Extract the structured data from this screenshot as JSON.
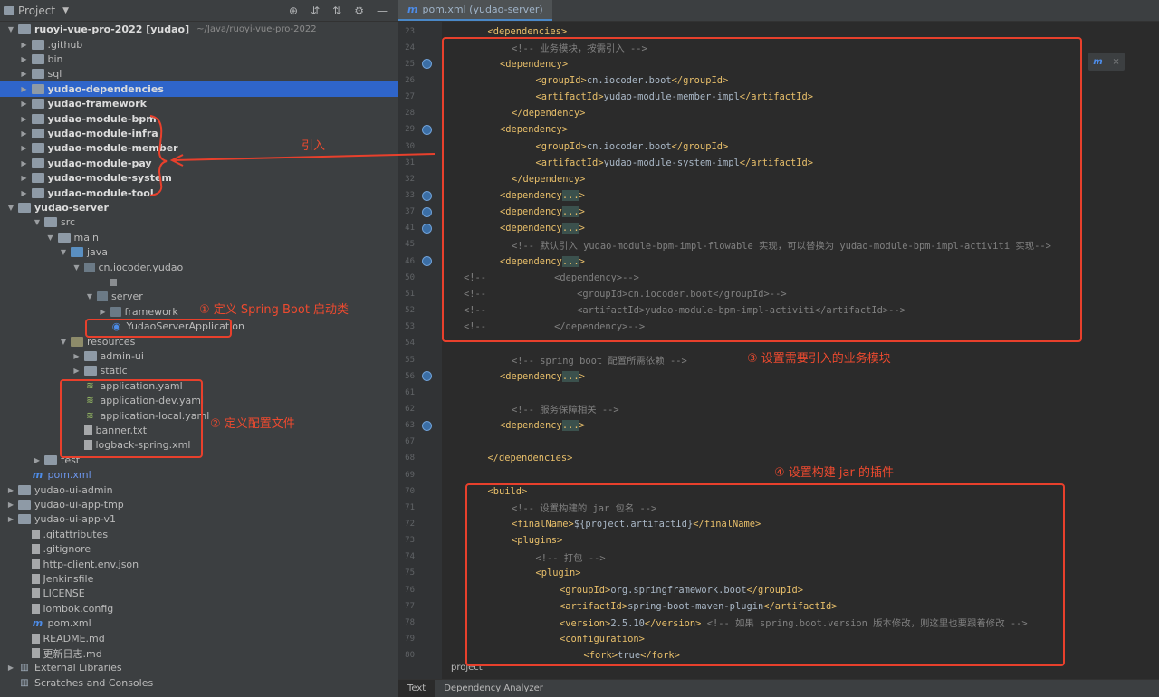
{
  "project_panel": {
    "title": "Project",
    "tree": [
      {
        "indent": 0,
        "arrow": "open",
        "icon": "folder",
        "label": "ruoyi-vue-pro-2022 [yudao]",
        "bold": true,
        "hint": "~/Java/ruoyi-vue-pro-2022"
      },
      {
        "indent": 1,
        "arrow": "closed",
        "icon": "folder",
        "label": ".github"
      },
      {
        "indent": 1,
        "arrow": "closed",
        "icon": "folder",
        "label": "bin"
      },
      {
        "indent": 1,
        "arrow": "closed",
        "icon": "folder",
        "label": "sql"
      },
      {
        "indent": 1,
        "arrow": "closed",
        "icon": "folder",
        "label": "yudao-dependencies",
        "bold": true,
        "selected": true
      },
      {
        "indent": 1,
        "arrow": "closed",
        "icon": "folder",
        "label": "yudao-framework",
        "bold": true
      },
      {
        "indent": 1,
        "arrow": "closed",
        "icon": "folder",
        "label": "yudao-module-bpm",
        "bold": true
      },
      {
        "indent": 1,
        "arrow": "closed",
        "icon": "folder",
        "label": "yudao-module-infra",
        "bold": true
      },
      {
        "indent": 1,
        "arrow": "closed",
        "icon": "folder",
        "label": "yudao-module-member",
        "bold": true
      },
      {
        "indent": 1,
        "arrow": "closed",
        "icon": "folder",
        "label": "yudao-module-pay",
        "bold": true
      },
      {
        "indent": 1,
        "arrow": "closed",
        "icon": "folder",
        "label": "yudao-module-system",
        "bold": true
      },
      {
        "indent": 1,
        "arrow": "closed",
        "icon": "folder",
        "label": "yudao-module-tool",
        "bold": true
      },
      {
        "indent": 0,
        "arrow": "open",
        "icon": "folder",
        "label": "yudao-server",
        "bold": true
      },
      {
        "indent": 2,
        "arrow": "open",
        "icon": "folder",
        "label": "src"
      },
      {
        "indent": 3,
        "arrow": "open",
        "icon": "folder",
        "label": "main"
      },
      {
        "indent": 4,
        "arrow": "open",
        "icon": "src-folder",
        "label": "java"
      },
      {
        "indent": 5,
        "arrow": "open",
        "icon": "pkg",
        "label": "cn.iocoder.yudao"
      },
      {
        "indent": 5,
        "arrow": "none",
        "icon": "pkg-empty",
        "label": ""
      },
      {
        "indent": 6,
        "arrow": "open",
        "icon": "pkg",
        "label": "server"
      },
      {
        "indent": 7,
        "arrow": "closed",
        "icon": "pkg",
        "label": "framework"
      },
      {
        "indent": 7,
        "arrow": "none",
        "icon": "spring",
        "label": "YudaoServerApplication"
      },
      {
        "indent": 4,
        "arrow": "open",
        "icon": "res-folder",
        "label": "resources"
      },
      {
        "indent": 5,
        "arrow": "closed",
        "icon": "folder",
        "label": "admin-ui"
      },
      {
        "indent": 5,
        "arrow": "closed",
        "icon": "folder",
        "label": "static"
      },
      {
        "indent": 5,
        "arrow": "none",
        "icon": "yaml",
        "label": "application.yaml"
      },
      {
        "indent": 5,
        "arrow": "none",
        "icon": "yaml",
        "label": "application-dev.yaml"
      },
      {
        "indent": 5,
        "arrow": "none",
        "icon": "yaml",
        "label": "application-local.yaml"
      },
      {
        "indent": 5,
        "arrow": "none",
        "icon": "file",
        "label": "banner.txt"
      },
      {
        "indent": 5,
        "arrow": "none",
        "icon": "file",
        "label": "logback-spring.xml"
      },
      {
        "indent": 2,
        "arrow": "closed",
        "icon": "folder",
        "label": "test"
      },
      {
        "indent": 1,
        "arrow": "none",
        "icon": "maven",
        "label": "pom.xml",
        "blue": true
      },
      {
        "indent": 0,
        "arrow": "closed",
        "icon": "folder",
        "label": "yudao-ui-admin"
      },
      {
        "indent": 0,
        "arrow": "closed",
        "icon": "folder",
        "label": "yudao-ui-app-tmp"
      },
      {
        "indent": 0,
        "arrow": "closed",
        "icon": "folder",
        "label": "yudao-ui-app-v1"
      },
      {
        "indent": 1,
        "arrow": "none",
        "icon": "file",
        "label": ".gitattributes"
      },
      {
        "indent": 1,
        "arrow": "none",
        "icon": "file",
        "label": ".gitignore"
      },
      {
        "indent": 1,
        "arrow": "none",
        "icon": "file",
        "label": "http-client.env.json"
      },
      {
        "indent": 1,
        "arrow": "none",
        "icon": "file",
        "label": "Jenkinsfile"
      },
      {
        "indent": 1,
        "arrow": "none",
        "icon": "file",
        "label": "LICENSE"
      },
      {
        "indent": 1,
        "arrow": "none",
        "icon": "file",
        "label": "lombok.config"
      },
      {
        "indent": 1,
        "arrow": "none",
        "icon": "maven",
        "label": "pom.xml"
      },
      {
        "indent": 1,
        "arrow": "none",
        "icon": "file",
        "label": "README.md"
      },
      {
        "indent": 1,
        "arrow": "none",
        "icon": "file",
        "label": "更新日志.md"
      },
      {
        "indent": 0,
        "arrow": "closed",
        "icon": "lib",
        "label": "External Libraries"
      },
      {
        "indent": 0,
        "arrow": "none",
        "icon": "lib",
        "label": "Scratches and Consoles"
      }
    ]
  },
  "editor": {
    "tab_label": "pom.xml (yudao-server)",
    "breadcrumb": "project",
    "bottom_tabs": [
      "Text",
      "Dependency Analyzer"
    ],
    "lines": [
      {
        "n": "23",
        "indent": 1,
        "segs": [
          [
            "tag",
            "<dependencies>"
          ]
        ]
      },
      {
        "n": "24",
        "indent": 2,
        "segs": [
          [
            "cmt",
            "<!-- 业务模块，按需引入 -->"
          ]
        ]
      },
      {
        "n": "25",
        "indent": 2,
        "bean": true,
        "segs": [
          [
            "tag",
            "<dependency>"
          ]
        ]
      },
      {
        "n": "26",
        "indent": 3,
        "segs": [
          [
            "tag",
            "<groupId>"
          ],
          [
            "text",
            "cn.iocoder.boot"
          ],
          [
            "tag",
            "</groupId>"
          ]
        ]
      },
      {
        "n": "27",
        "indent": 3,
        "segs": [
          [
            "tag",
            "<artifactId>"
          ],
          [
            "text",
            "yudao-module-member-impl"
          ],
          [
            "tag",
            "</artifactId>"
          ]
        ]
      },
      {
        "n": "28",
        "indent": 2,
        "segs": [
          [
            "tag",
            "</dependency>"
          ]
        ]
      },
      {
        "n": "29",
        "indent": 2,
        "bean": true,
        "segs": [
          [
            "tag",
            "<dependency>"
          ]
        ]
      },
      {
        "n": "30",
        "indent": 3,
        "segs": [
          [
            "tag",
            "<groupId>"
          ],
          [
            "text",
            "cn.iocoder.boot"
          ],
          [
            "tag",
            "</groupId>"
          ]
        ]
      },
      {
        "n": "31",
        "indent": 3,
        "segs": [
          [
            "tag",
            "<artifactId>"
          ],
          [
            "text",
            "yudao-module-system-impl"
          ],
          [
            "tag",
            "</artifactId>"
          ]
        ]
      },
      {
        "n": "32",
        "indent": 2,
        "segs": [
          [
            "tag",
            "</dependency>"
          ]
        ]
      },
      {
        "n": "33",
        "indent": 2,
        "bean": true,
        "segs": [
          [
            "tag",
            "<dependency"
          ],
          [
            "fold",
            "..."
          ],
          [
            "tag",
            ">"
          ]
        ]
      },
      {
        "n": "37",
        "indent": 2,
        "bean": true,
        "segs": [
          [
            "tag",
            "<dependency"
          ],
          [
            "fold",
            "..."
          ],
          [
            "tag",
            ">"
          ]
        ]
      },
      {
        "n": "41",
        "indent": 2,
        "bean": true,
        "segs": [
          [
            "tag",
            "<dependency"
          ],
          [
            "fold",
            "..."
          ],
          [
            "tag",
            ">"
          ]
        ]
      },
      {
        "n": "45",
        "indent": 2,
        "segs": [
          [
            "cmt",
            "<!-- 默认引入 yudao-module-bpm-impl-flowable 实现，可以替换为 yudao-module-bpm-impl-activiti 实现-->"
          ]
        ]
      },
      {
        "n": "46",
        "indent": 2,
        "bean": true,
        "segs": [
          [
            "tag",
            "<dependency"
          ],
          [
            "fold",
            "..."
          ],
          [
            "tag",
            ">"
          ]
        ]
      },
      {
        "n": "50",
        "indent": 0,
        "segs": [
          [
            "cmt",
            "<!--            <dependency>-->"
          ]
        ]
      },
      {
        "n": "51",
        "indent": 0,
        "segs": [
          [
            "cmt",
            "<!--                <groupId>cn.iocoder.boot</groupId>-->"
          ]
        ]
      },
      {
        "n": "52",
        "indent": 0,
        "segs": [
          [
            "cmt",
            "<!--                <artifactId>yudao-module-bpm-impl-activiti</artifactId>-->"
          ]
        ]
      },
      {
        "n": "53",
        "indent": 0,
        "segs": [
          [
            "cmt",
            "<!--            </dependency>-->"
          ]
        ]
      },
      {
        "n": "54",
        "indent": 0,
        "segs": []
      },
      {
        "n": "55",
        "indent": 2,
        "segs": [
          [
            "cmt",
            "<!-- spring boot 配置所需依赖 -->"
          ]
        ]
      },
      {
        "n": "56",
        "indent": 2,
        "bean": true,
        "segs": [
          [
            "tag",
            "<dependency"
          ],
          [
            "fold",
            "..."
          ],
          [
            "tag",
            ">"
          ]
        ]
      },
      {
        "n": "61",
        "indent": 0,
        "segs": []
      },
      {
        "n": "62",
        "indent": 2,
        "segs": [
          [
            "cmt",
            "<!-- 服务保障相关 -->"
          ]
        ]
      },
      {
        "n": "63",
        "indent": 2,
        "bean": true,
        "segs": [
          [
            "tag",
            "<dependency"
          ],
          [
            "fold",
            "..."
          ],
          [
            "tag",
            ">"
          ]
        ]
      },
      {
        "n": "67",
        "indent": 0,
        "segs": []
      },
      {
        "n": "68",
        "indent": 1,
        "segs": [
          [
            "tag",
            "</dependencies>"
          ]
        ]
      },
      {
        "n": "69",
        "indent": 0,
        "segs": []
      },
      {
        "n": "70",
        "indent": 1,
        "segs": [
          [
            "tag",
            "<build>"
          ]
        ]
      },
      {
        "n": "71",
        "indent": 2,
        "segs": [
          [
            "cmt",
            "<!-- 设置构建的 jar 包名 -->"
          ]
        ]
      },
      {
        "n": "72",
        "indent": 2,
        "segs": [
          [
            "tag",
            "<finalName>"
          ],
          [
            "text",
            "${project.artifactId}"
          ],
          [
            "tag",
            "</finalName>"
          ]
        ]
      },
      {
        "n": "73",
        "indent": 2,
        "segs": [
          [
            "tag",
            "<plugins>"
          ]
        ]
      },
      {
        "n": "74",
        "indent": 3,
        "segs": [
          [
            "cmt",
            "<!-- 打包 -->"
          ]
        ]
      },
      {
        "n": "75",
        "indent": 3,
        "segs": [
          [
            "tag",
            "<plugin>"
          ]
        ]
      },
      {
        "n": "76",
        "indent": 4,
        "segs": [
          [
            "tag",
            "<groupId>"
          ],
          [
            "text",
            "org.springframework.boot"
          ],
          [
            "tag",
            "</groupId>"
          ]
        ]
      },
      {
        "n": "77",
        "indent": 4,
        "segs": [
          [
            "tag",
            "<artifactId>"
          ],
          [
            "text",
            "spring-boot-maven-plugin"
          ],
          [
            "tag",
            "</artifactId>"
          ]
        ]
      },
      {
        "n": "78",
        "indent": 4,
        "segs": [
          [
            "tag",
            "<version>"
          ],
          [
            "text",
            "2.5.10"
          ],
          [
            "tag",
            "</version>"
          ],
          [
            "text",
            " "
          ],
          [
            "cmt",
            "<!-- 如果 spring.boot.version 版本修改，则这里也要跟着修改 -->"
          ]
        ]
      },
      {
        "n": "79",
        "indent": 4,
        "segs": [
          [
            "tag",
            "<configuration>"
          ]
        ]
      },
      {
        "n": "80",
        "indent": 5,
        "segs": [
          [
            "tag",
            "<fork>"
          ],
          [
            "text",
            "true"
          ],
          [
            "tag",
            "</fork>"
          ]
        ]
      }
    ]
  },
  "annotations": {
    "import_label": "引入",
    "step1": "① 定义 Spring Boot 启动类",
    "step2": "② 定义配置文件",
    "step3": "③ 设置需要引入的业务模块",
    "step4": "④ 设置构建 jar 的插件"
  },
  "colors": {
    "annotation": "#e8402c",
    "selection": "#2f65ca",
    "xml_tag": "#e8bf6a",
    "comment": "#808080",
    "text": "#a9b7c6"
  }
}
